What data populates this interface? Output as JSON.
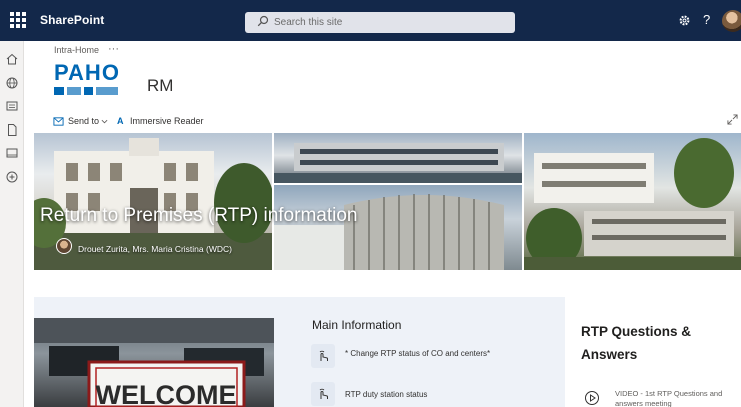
{
  "suite_bar": {
    "brand": "SharePoint",
    "search_placeholder": "Search this site",
    "help_label": "?"
  },
  "site": {
    "breadcrumb": "Intra-Home",
    "breadcrumb_more": "···",
    "logo_text": "PAHO",
    "title": "RM"
  },
  "command_bar": {
    "send_to": "Send to",
    "immersive_reader": "Immersive Reader"
  },
  "hero": {
    "title": "Return to Premises (RTP) information",
    "author": "Drouet Zurita, Mrs. Maria Cristina (WDC)"
  },
  "welcome": {
    "sign_text": "WELCOME"
  },
  "main_info": {
    "title": "Main Information",
    "links": [
      {
        "label": "* Change RTP status of CO and centers*",
        "icon": "touch-icon"
      },
      {
        "label": "RTP duty station status",
        "icon": "touch-icon"
      }
    ]
  },
  "qa": {
    "title": "RTP Questions & Answers",
    "items": [
      {
        "label": "VIDEO - 1st RTP Questions and answers meeting",
        "icon": "play-icon"
      }
    ]
  },
  "colors": {
    "suite_bar": "#13284a",
    "paho_blue": "#0067b3",
    "section_bg": "#eef2f8"
  }
}
